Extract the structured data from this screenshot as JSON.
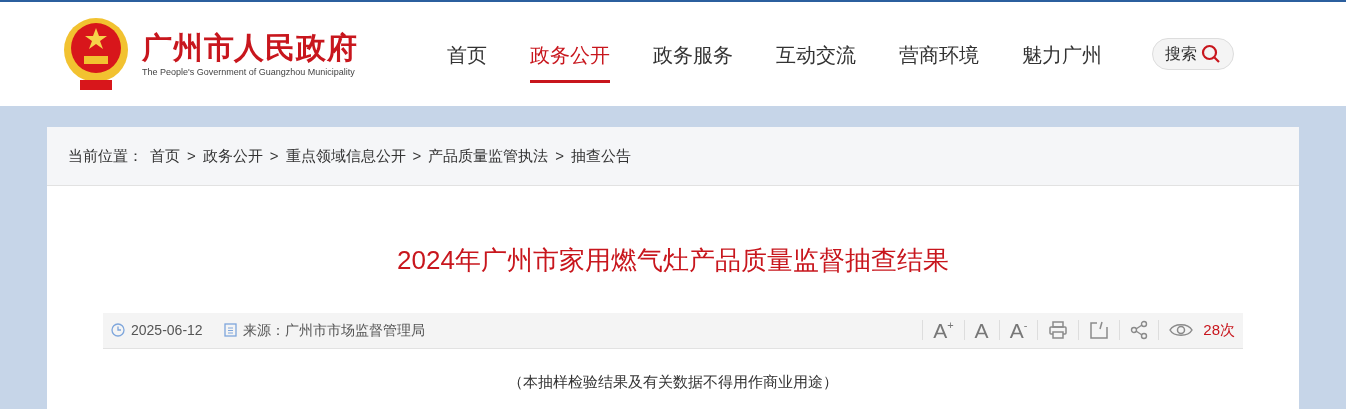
{
  "header": {
    "site_title": "广州市人民政府",
    "site_subtitle": "The People's Government of Guangzhou Municipality",
    "nav": [
      {
        "label": "首页",
        "selected": false
      },
      {
        "label": "政务公开",
        "selected": true
      },
      {
        "label": "政务服务",
        "selected": false
      },
      {
        "label": "互动交流",
        "selected": false
      },
      {
        "label": "营商环境",
        "selected": false
      },
      {
        "label": "魅力广州",
        "selected": false
      }
    ],
    "search_label": "搜索"
  },
  "breadcrumb": {
    "prefix": "当前位置：",
    "items": [
      "首页",
      "政务公开",
      "重点领域信息公开",
      "产品质量监管执法",
      "抽查公告"
    ],
    "separator": ">"
  },
  "article": {
    "title": "2024年广州市家用燃气灶产品质量监督抽查结果",
    "date": "2025-06-12",
    "source": "来源：广州市市场监督管理局",
    "font_tools": [
      {
        "label": "A",
        "mark": "+"
      },
      {
        "label": "A"
      },
      {
        "label": "A",
        "mark": "-"
      }
    ],
    "views": "28次",
    "note": "（本抽样检验结果及有关数据不得用作商业用途）"
  }
}
